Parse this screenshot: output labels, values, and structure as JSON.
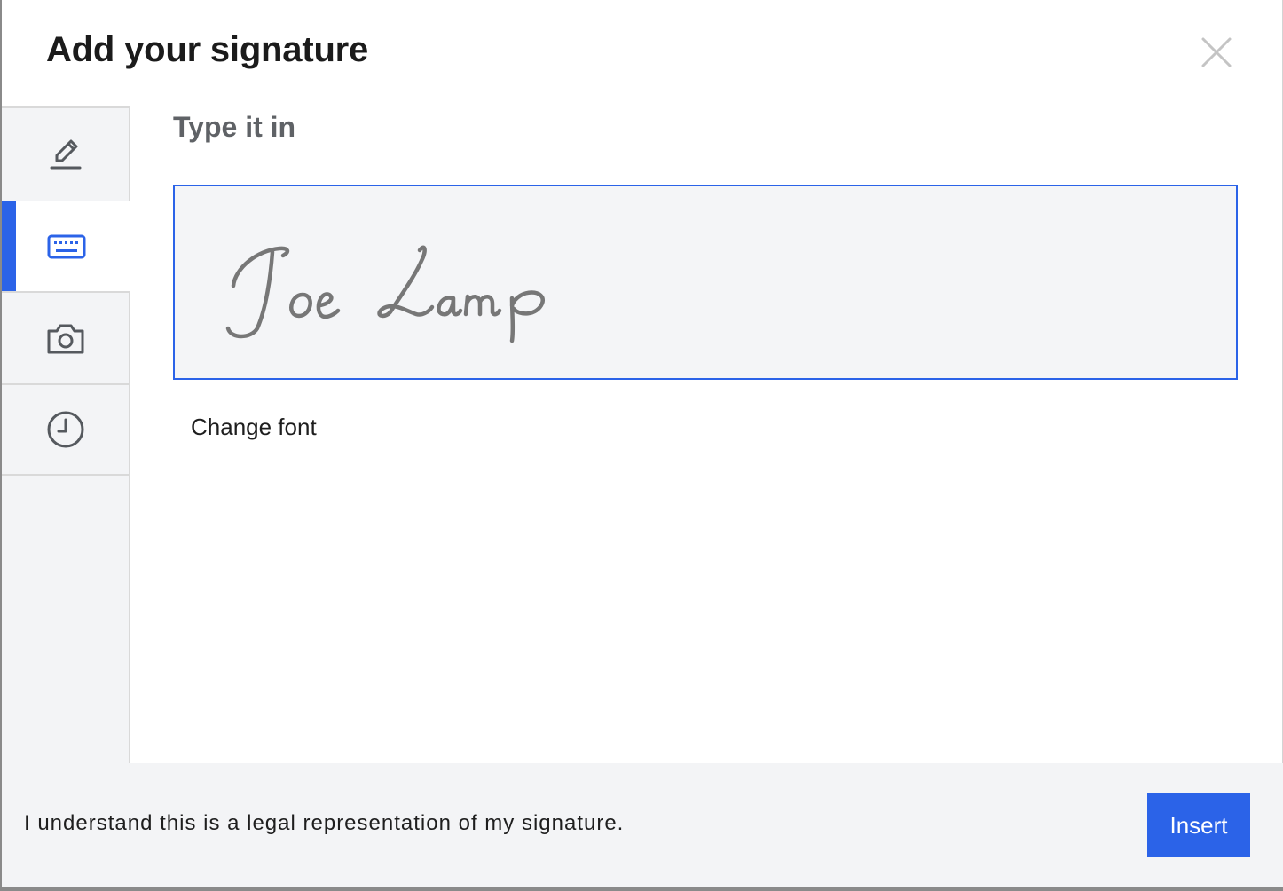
{
  "dialog": {
    "title": "Add your signature",
    "close_icon": "close-icon"
  },
  "tabs": [
    {
      "name": "draw",
      "icon": "pencil-icon",
      "active": false
    },
    {
      "name": "type",
      "icon": "keyboard-icon",
      "active": true
    },
    {
      "name": "upload",
      "icon": "camera-icon",
      "active": false
    },
    {
      "name": "saved",
      "icon": "clock-icon",
      "active": false
    }
  ],
  "main": {
    "section_title": "Type it in",
    "signature_value": "Joe Lamp",
    "change_font_label": "Change font"
  },
  "footer": {
    "legal_text": "I understand this is a legal representation of my signature.",
    "insert_label": "Insert"
  },
  "colors": {
    "accent": "#2b63e8",
    "panel_bg": "#f3f4f6",
    "signature_ink": "#777777"
  }
}
